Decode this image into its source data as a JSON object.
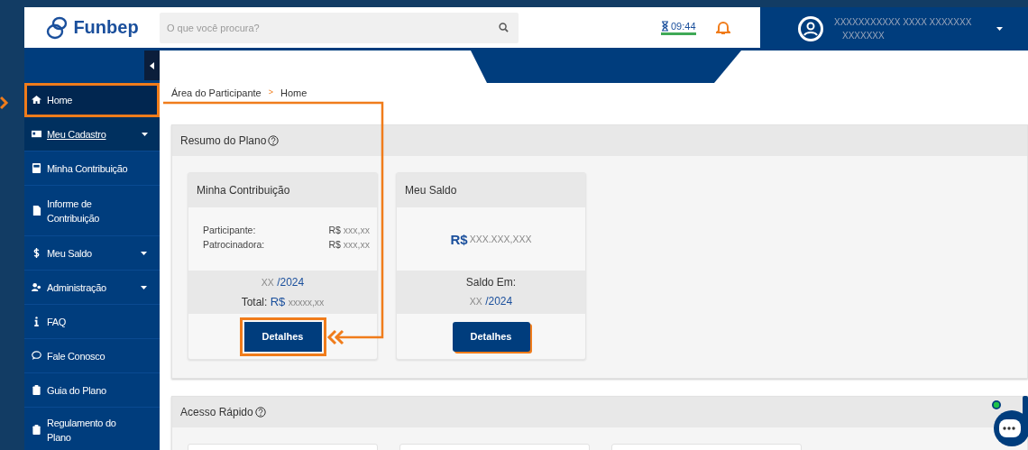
{
  "header": {
    "logo": "Funbep",
    "search": {
      "placeholder": "O que você procura?"
    },
    "session_timer": "09:44",
    "user": {
      "name_line_1": "XXXXXXXXXXX XXXX XXXXXXX",
      "name_line_2": "XXXXXXX"
    }
  },
  "sidebar": {
    "items": [
      {
        "label": "Home",
        "selected": true,
        "hovered": false,
        "has_submenu": false,
        "highlighted": true
      },
      {
        "label": "Meu Cadastro",
        "selected": false,
        "hovered": true,
        "has_submenu": true,
        "highlighted": false
      },
      {
        "label": "Minha Contribuição",
        "selected": false,
        "hovered": false,
        "has_submenu": false,
        "highlighted": false
      },
      {
        "label": "Informe de Contribuição",
        "selected": false,
        "hovered": false,
        "has_submenu": false,
        "highlighted": false
      },
      {
        "label": "Meu Saldo",
        "selected": false,
        "hovered": false,
        "has_submenu": true,
        "highlighted": false
      },
      {
        "label": "Administração",
        "selected": false,
        "hovered": false,
        "has_submenu": true,
        "highlighted": false
      },
      {
        "label": "FAQ",
        "selected": false,
        "hovered": false,
        "has_submenu": false,
        "highlighted": false
      },
      {
        "label": "Fale Conosco",
        "selected": false,
        "hovered": false,
        "has_submenu": false,
        "highlighted": false
      },
      {
        "label": "Guia do Plano",
        "selected": false,
        "hovered": false,
        "has_submenu": false,
        "highlighted": false
      },
      {
        "label": "Regulamento do Plano",
        "selected": false,
        "hovered": false,
        "has_submenu": false,
        "highlighted": false
      }
    ]
  },
  "breadcrumb": {
    "items": [
      "Área do Participante",
      "Home"
    ],
    "separator": ">"
  },
  "summary_panel": {
    "title": "Resumo do Plano",
    "cards": [
      {
        "kind": "contribution",
        "title": "Minha Contribuição",
        "rows": [
          {
            "label": "Participante:",
            "currency": "R$",
            "value": "xxx,xx"
          },
          {
            "label": "Patrocinadora:",
            "currency": "R$",
            "value": "xxx,xx"
          }
        ],
        "period_month": "XX",
        "period_year": "/2024",
        "total_label": "Total:",
        "total_currency": "R$",
        "total_value": "xxxxx,xx",
        "button": {
          "label": "Detalhes",
          "highlighted": true
        }
      },
      {
        "kind": "balance",
        "title": "Meu Saldo",
        "currency": "R$",
        "value": "XXX.XXX,XXX",
        "date_label": "Saldo Em:",
        "period_month": "XX",
        "period_year": "/2024",
        "button": {
          "label": "Detalhes",
          "highlighted": false
        }
      }
    ]
  },
  "quick_access_panel": {
    "title": "Acesso Rápido"
  }
}
